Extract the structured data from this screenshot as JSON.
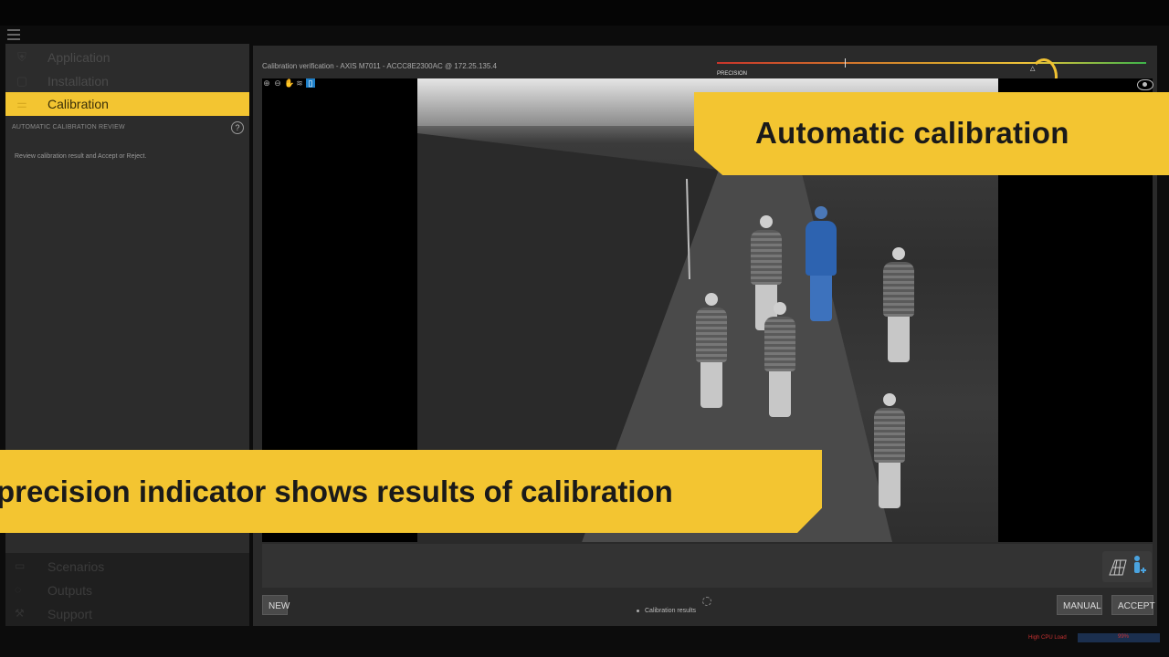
{
  "sidebar": {
    "items": [
      {
        "label": "Application",
        "icon": "shield-icon"
      },
      {
        "label": "Installation",
        "icon": "clipboard-icon"
      },
      {
        "label": "Calibration",
        "icon": "ruler-icon",
        "active": true
      }
    ],
    "section_title": "AUTOMATIC CALIBRATION REVIEW",
    "help": "?",
    "instruction": "Review calibration result and Accept or Reject.",
    "lower_items": [
      {
        "label": "Scenarios",
        "icon": "scenarios-icon"
      },
      {
        "label": "Outputs",
        "icon": "outputs-icon"
      },
      {
        "label": "Support",
        "icon": "wrench-icon"
      }
    ]
  },
  "main": {
    "verification_title": "Calibration verification - AXIS M7011 - ACCC8E2300AC @ 172.25.135.4",
    "precision_label": "PRECISION",
    "precision_level": 0.73,
    "precision_marker": "△",
    "buttons": {
      "new": "NEW",
      "manual": "MANUAL",
      "accept": "ACCEPT"
    },
    "results_label": "Calibration results"
  },
  "callouts": {
    "top": "Automatic calibration",
    "bottom": "precision indicator shows results of calibration"
  },
  "footer": {
    "warning": "High CPU Load",
    "cpu": "99%"
  },
  "colors": {
    "accent": "#f3c531",
    "selection": "#1e7fc8"
  }
}
